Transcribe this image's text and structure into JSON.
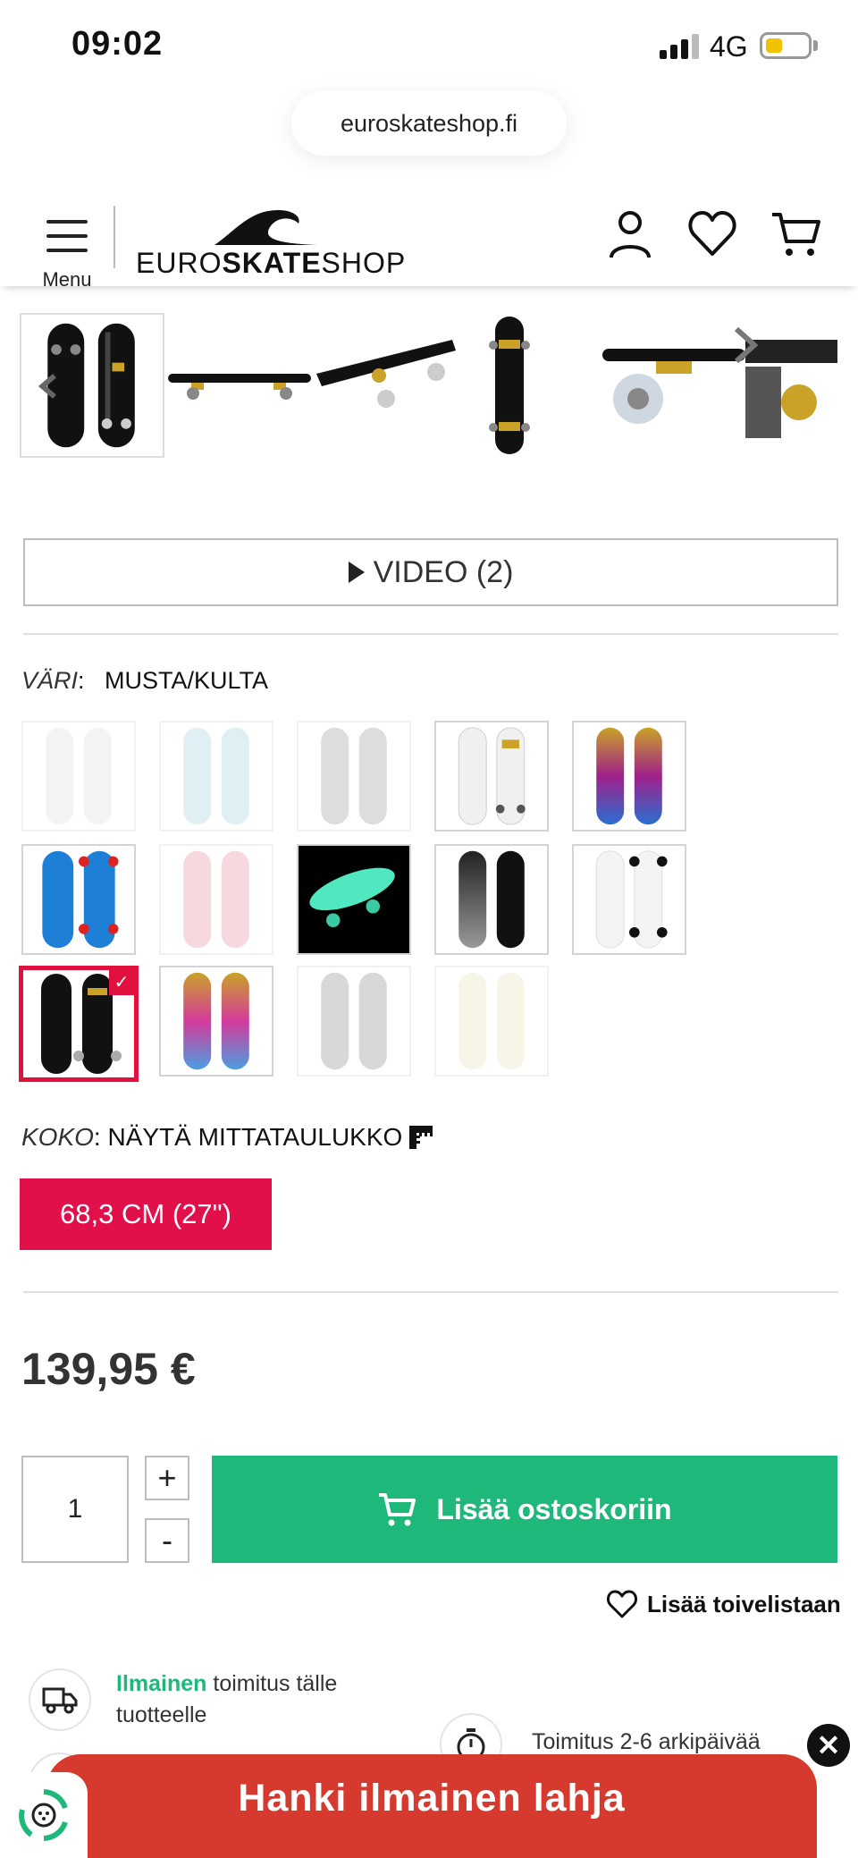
{
  "status_bar": {
    "time": "09:02",
    "network": "4G"
  },
  "browser": {
    "url": "euroskateshop.fi"
  },
  "header": {
    "menu_label": "Menu",
    "logo_light": "EURO",
    "logo_bold": "SKATE",
    "logo_light_2": "SHOP"
  },
  "video": {
    "label": "VIDEO (2)"
  },
  "color": {
    "label": "VÄRI",
    "value": "MUSTA/KULTA"
  },
  "size": {
    "label": "KOKO",
    "chart_link": "NÄYTÄ MITTATAULUKKO",
    "selected": "68,3 CM (27\")"
  },
  "price": "139,95 €",
  "quantity": {
    "value": "1",
    "plus": "+",
    "minus": "-"
  },
  "cart": {
    "add_label": "Lisää ostoskoriin"
  },
  "wishlist": {
    "label": "Lisää toivelistaan"
  },
  "delivery": {
    "free_accent": "Ilmainen",
    "free_rest": "toimitus tälle tuotteelle",
    "time": "Toimitus 2-6 arkipäivää"
  },
  "promo": {
    "label": "Hanki ilmainen lahja"
  },
  "colors": {
    "brand_red": "#e2104a",
    "cart_green": "#1db87a",
    "promo_red": "#d63a2e"
  }
}
